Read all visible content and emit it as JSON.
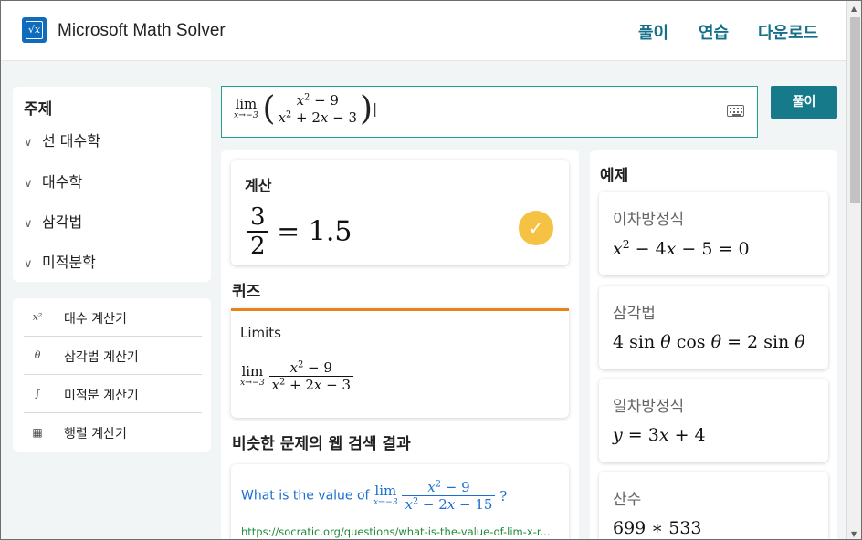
{
  "header": {
    "app_title": "Microsoft Math Solver",
    "nav": [
      "풀이",
      "연습",
      "다운로드"
    ]
  },
  "sidebar": {
    "topics_heading": "주제",
    "topics": [
      "선 대수학",
      "대수학",
      "삼각법",
      "미적분학"
    ],
    "calculators": [
      {
        "label": "대수 계산기",
        "icon": "x-squared-icon"
      },
      {
        "label": "삼각법 계산기",
        "icon": "theta-icon"
      },
      {
        "label": "미적분 계산기",
        "icon": "integral-icon"
      },
      {
        "label": "행렬 계산기",
        "icon": "matrix-icon"
      }
    ]
  },
  "input": {
    "expression": "lim x→-3 ((x^2 - 9)/(x^2 + 2x - 3))",
    "solve_label": "풀이"
  },
  "result": {
    "title": "계산",
    "numerator": "3",
    "denominator": "2",
    "value": "= 1.5"
  },
  "quiz": {
    "heading": "퀴즈",
    "label": "Limits",
    "expression": "lim x→-3 (x^2 - 9)/(x^2 + 2x - 3)"
  },
  "web": {
    "heading": "비슷한 문제의 웹 검색 결과",
    "link_text": "What is the value of",
    "link_expr": "lim x→-3 (x^2 - 9)/(x^2 - 2x - 15) ?",
    "url": "https://socratic.org/questions/what-is-the-value-of-lim-x-r..."
  },
  "examples": {
    "heading": "예제",
    "items": [
      {
        "title": "이차방정식",
        "expr": "x^2 - 4x - 5 = 0"
      },
      {
        "title": "삼각법",
        "expr": "4 sin θ cos θ = 2 sin θ"
      },
      {
        "title": "일차방정식",
        "expr": "y = 3x + 4"
      },
      {
        "title": "산수",
        "expr": "699 * 533"
      }
    ]
  },
  "colors": {
    "accent": "#167a8a",
    "nav_text": "#16708a",
    "input_border": "#1f9e8e",
    "check": "#f5c243",
    "quiz_bar": "#e8821c",
    "link": "#1a6fd1",
    "url": "#1e8a3a"
  }
}
